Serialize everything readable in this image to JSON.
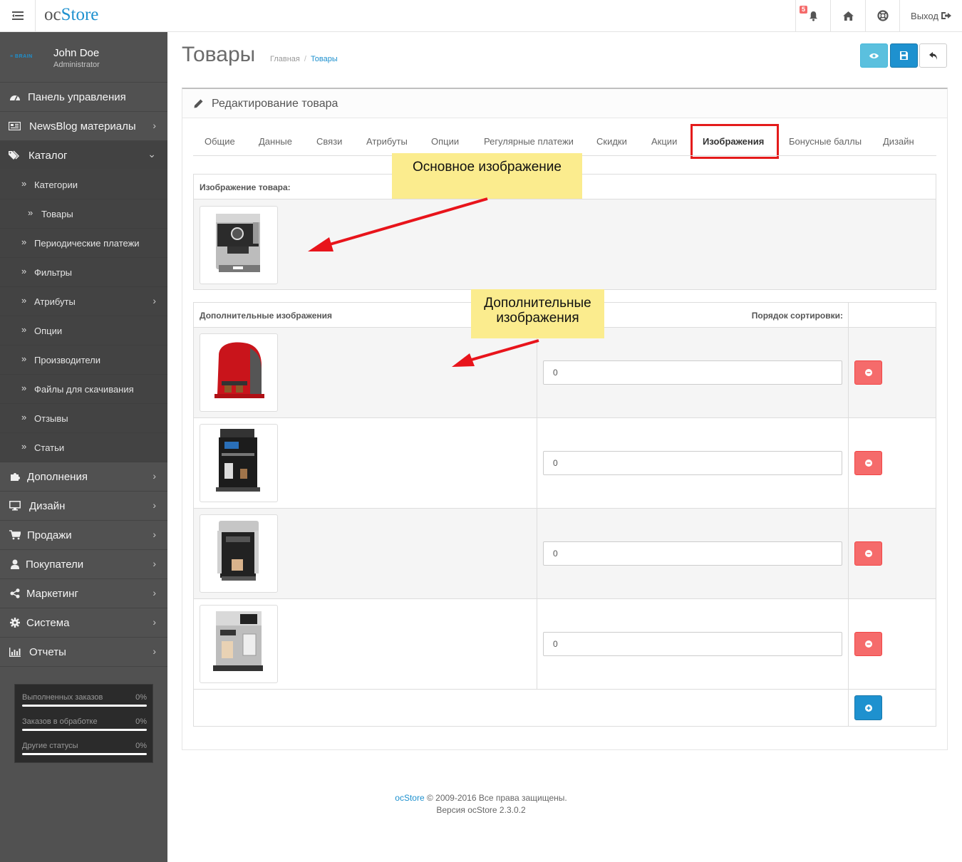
{
  "header": {
    "logo_oc": "oc",
    "logo_store": "Store",
    "notification_count": "5",
    "logout_label": "Выход"
  },
  "sidebar": {
    "brand_logo_text": "≡ BRAIN",
    "user_name": "John Doe",
    "user_role": "Administrator",
    "menu": [
      {
        "label": "Панель управления",
        "icon": "dashboard-icon"
      },
      {
        "label": "NewsBlog материалы",
        "icon": "newspaper-icon"
      },
      {
        "label": "Каталог",
        "icon": "tags-icon"
      }
    ],
    "catalog_items": [
      {
        "label": "Категории"
      },
      {
        "label": "Товары"
      },
      {
        "label": "Периодические платежи"
      },
      {
        "label": "Фильтры"
      },
      {
        "label": "Атрибуты"
      },
      {
        "label": "Опции"
      },
      {
        "label": "Производители"
      },
      {
        "label": "Файлы для скачивания"
      },
      {
        "label": "Отзывы"
      },
      {
        "label": "Статьи"
      }
    ],
    "menu_bottom": [
      {
        "label": "Дополнения",
        "icon": "puzzle-icon"
      },
      {
        "label": "Дизайн",
        "icon": "desktop-icon"
      },
      {
        "label": "Продажи",
        "icon": "cart-icon"
      },
      {
        "label": "Покупатели",
        "icon": "user-icon"
      },
      {
        "label": "Маркетинг",
        "icon": "share-icon"
      },
      {
        "label": "Система",
        "icon": "cog-icon"
      },
      {
        "label": "Отчеты",
        "icon": "bar-chart-icon"
      }
    ],
    "stats": [
      {
        "label": "Выполненных заказов",
        "value": "0%",
        "fraction": 0
      },
      {
        "label": "Заказов в обработке",
        "value": "0%",
        "fraction": 0
      },
      {
        "label": "Другие статусы",
        "value": "0%",
        "fraction": 0
      }
    ]
  },
  "page": {
    "title": "Товары",
    "breadcrumb_home": "Главная",
    "breadcrumb_current": "Товары",
    "panel_title": "Редактирование товара"
  },
  "tabs": [
    {
      "label": "Общие"
    },
    {
      "label": "Данные"
    },
    {
      "label": "Связи"
    },
    {
      "label": "Атрибуты"
    },
    {
      "label": "Опции"
    },
    {
      "label": "Регулярные платежи"
    },
    {
      "label": "Скидки"
    },
    {
      "label": "Акции"
    },
    {
      "label": "Изображения",
      "active": true
    },
    {
      "label": "Бонусные баллы"
    },
    {
      "label": "Дизайн"
    }
  ],
  "main_image": {
    "header": "Изображение товара:"
  },
  "additional_images": {
    "header_images": "Дополнительные изображения",
    "header_sort": "Порядок сортировки:",
    "rows": [
      {
        "sort_order": "0"
      },
      {
        "sort_order": "0"
      },
      {
        "sort_order": "0"
      },
      {
        "sort_order": "0"
      }
    ]
  },
  "annotations": {
    "main": "Основное изображение",
    "additional_line1": "Дополнительные",
    "additional_line2": "изображения"
  },
  "footer": {
    "brand": "ocStore",
    "copyright": "© 2009-2016 Все права защищены.",
    "version": "Версия ocStore 2.3.0.2"
  },
  "colors": {
    "accent": "#1e91cf",
    "sidebar": "#515151",
    "danger": "#f56b6b",
    "info": "#5bc0de",
    "highlight_box": "#e41b1b",
    "annotation_bg": "#fbec8e"
  }
}
